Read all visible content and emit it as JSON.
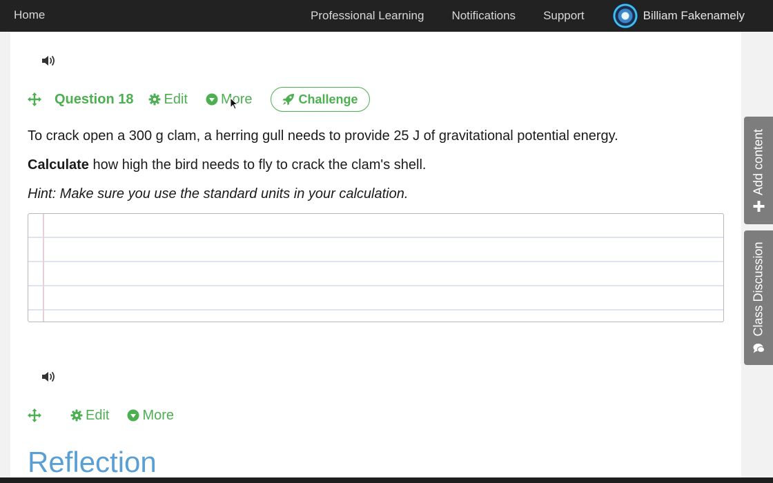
{
  "navbar": {
    "home": "Home",
    "links": [
      "Professional Learning",
      "Notifications",
      "Support"
    ],
    "user_name": "Billiam Fakenamely"
  },
  "question18": {
    "title": "Question 18",
    "edit_label": "Edit",
    "more_label": "More",
    "challenge_label": "Challenge",
    "text_line1": "To crack open a 300 g clam, a herring gull needs to provide 25 J of gravitational potential energy.",
    "text_line2_bold": "Calculate",
    "text_line2_rest": " how high the bird needs to fly to crack the clam's shell.",
    "hint": "Hint: Make sure you use the standard units in your calculation.",
    "answer_value": ""
  },
  "block2": {
    "edit_label": "Edit",
    "more_label": "More"
  },
  "reflection_heading": "Reflection",
  "side_tabs": {
    "add_content": "Add content",
    "class_discussion": "Class Discussion"
  },
  "colors": {
    "accent_green": "#4caf50",
    "navbar_bg": "#222222",
    "reflection_blue": "#5a9fd4",
    "side_tab_bg": "#7d7d7d"
  },
  "icons": {
    "speaker": "speaker-icon",
    "move": "move-icon",
    "gear": "gear-icon",
    "more": "chevron-down-circle-icon",
    "rocket": "rocket-icon",
    "plus": "plus-icon",
    "chat": "chat-bubble-icon"
  }
}
